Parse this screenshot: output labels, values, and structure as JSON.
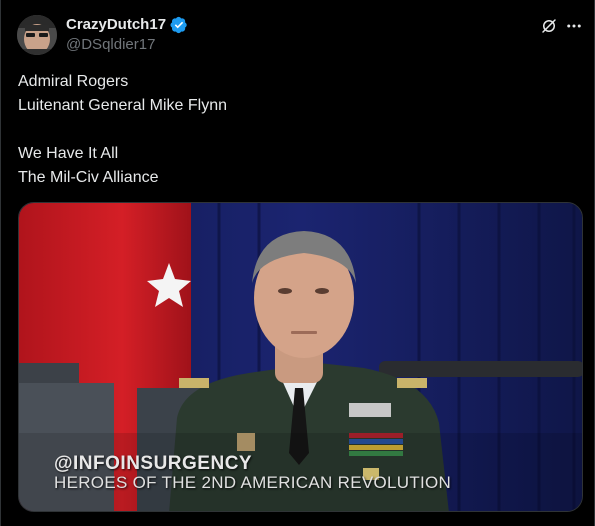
{
  "author": {
    "display_name": "CrazyDutch17",
    "handle": "@DSqldier17",
    "verified": true,
    "avatar_icon": "avatar-photo"
  },
  "header_actions": {
    "grok_icon": "grok-icon",
    "more_icon": "more-icon"
  },
  "post": {
    "lines": [
      "Admiral Rogers",
      "Luitenant General Mike Flynn",
      "",
      "We Have It All",
      "The Mil-Civ Alliance"
    ]
  },
  "media": {
    "type": "video",
    "overlay_line_1": "@INFOINSURGENCY",
    "overlay_line_2": "HEROES OF THE 2ND AMERICAN REVOLUTION"
  },
  "colors": {
    "background": "#000000",
    "text_primary": "#e7e9ea",
    "text_secondary": "#71767b",
    "verified_blue": "#1d9bf0",
    "border": "#2f3336"
  }
}
